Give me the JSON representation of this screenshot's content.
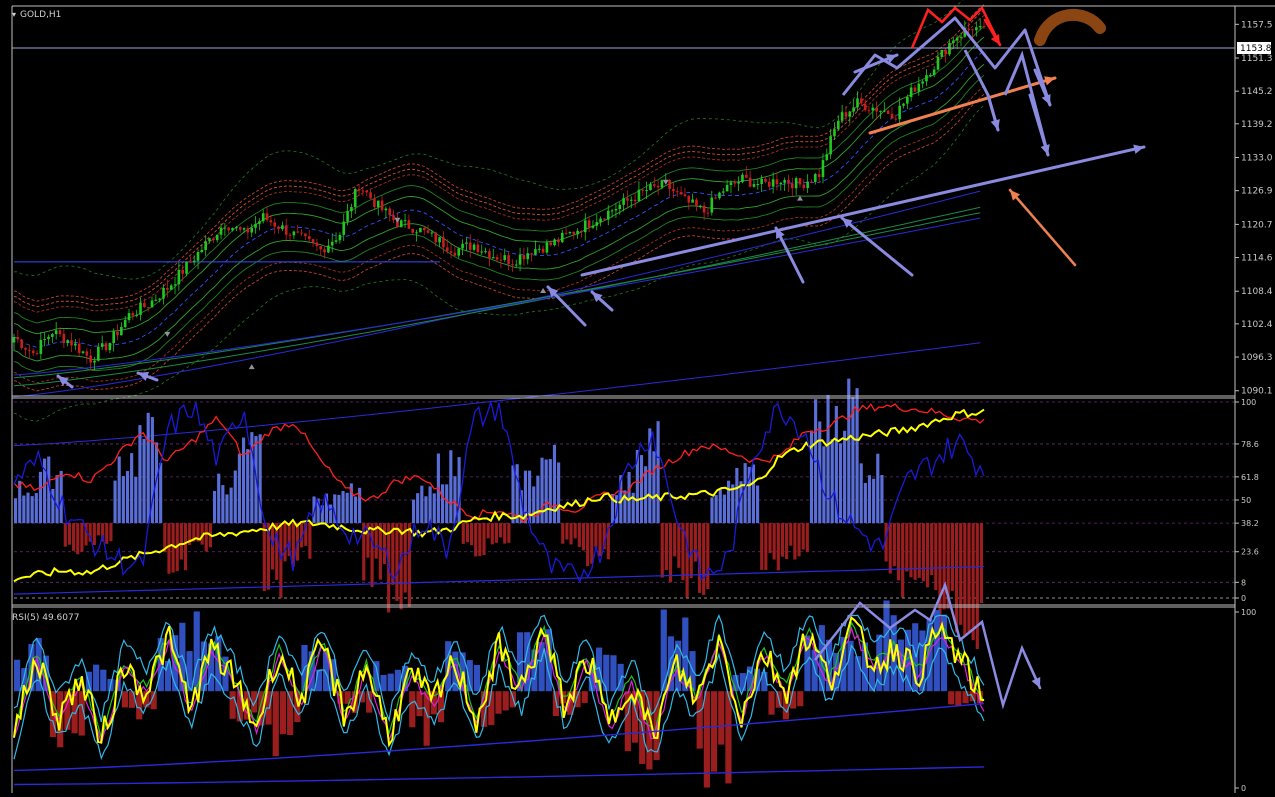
{
  "window": {
    "symbol_label": "GOLD,H1",
    "rsi_label": "RSI(5) 49.6077",
    "current_price": "1153.8",
    "colors": {
      "background": "#000000",
      "candle_up": "#22c822",
      "candle_down": "#c81e1e",
      "axis_text": "#c8c8c8",
      "annotation_blue": "#8a8ae0",
      "annotation_orange": "#f08050",
      "annotation_red": "#ff2020",
      "annotation_brown": "#8b4513",
      "rsi_yellow": "#ffff00",
      "line_red": "#ff2020",
      "line_blue": "#1a1ad8",
      "hist_up": "#5a6ed8",
      "hist_down": "#9a1e1e"
    }
  },
  "chart_data": [
    {
      "type": "candlestick",
      "title": "GOLD,H1",
      "y_tick_labels": [
        "1157.5",
        "1151.3",
        "1145.2",
        "1139.2",
        "1133.0",
        "1126.9",
        "1120.7",
        "1114.6",
        "1108.4",
        "1102.4",
        "1096.3",
        "1090.1"
      ],
      "ylim": [
        1089.5,
        1160.5
      ],
      "current_price": 1153.8,
      "price_path": [
        [
          0,
          1100
        ],
        [
          5,
          1097
        ],
        [
          10,
          1101
        ],
        [
          15,
          1099
        ],
        [
          20,
          1096
        ],
        [
          25,
          1099
        ],
        [
          30,
          1104
        ],
        [
          35,
          1106
        ],
        [
          40,
          1109
        ],
        [
          45,
          1113
        ],
        [
          50,
          1117
        ],
        [
          55,
          1121
        ],
        [
          60,
          1119
        ],
        [
          65,
          1122
        ],
        [
          70,
          1120
        ],
        [
          75,
          1118
        ],
        [
          80,
          1116
        ],
        [
          85,
          1119
        ],
        [
          90,
          1128
        ],
        [
          95,
          1124
        ],
        [
          100,
          1121
        ],
        [
          105,
          1120
        ],
        [
          110,
          1118
        ],
        [
          115,
          1116
        ],
        [
          120,
          1117
        ],
        [
          125,
          1115
        ],
        [
          130,
          1114
        ],
        [
          135,
          1116
        ],
        [
          140,
          1117
        ],
        [
          145,
          1119
        ],
        [
          150,
          1121
        ],
        [
          155,
          1123
        ],
        [
          160,
          1125
        ],
        [
          165,
          1127
        ],
        [
          170,
          1128
        ],
        [
          175,
          1125
        ],
        [
          180,
          1123
        ],
        [
          185,
          1127
        ],
        [
          190,
          1129
        ],
        [
          195,
          1128
        ],
        [
          200,
          1129
        ],
        [
          205,
          1128
        ],
        [
          210,
          1130
        ],
        [
          215,
          1140
        ],
        [
          220,
          1143
        ],
        [
          225,
          1142
        ],
        [
          230,
          1141
        ],
        [
          235,
          1146
        ],
        [
          240,
          1150
        ],
        [
          245,
          1155
        ],
        [
          250,
          1157
        ],
        [
          253,
          1156
        ]
      ],
      "n_bars": 254,
      "grid": false
    },
    {
      "type": "line",
      "title": "",
      "y_tick_labels": [
        "100",
        "78.6",
        "61.8",
        "50",
        "38.2",
        "23.6",
        "8",
        "0"
      ],
      "ylim": [
        0,
        100
      ],
      "series": [
        {
          "name": "",
          "color": "#ff2020",
          "values": [
            58,
            55,
            65,
            60,
            72,
            85,
            70,
            80,
            92,
            72,
            85,
            90,
            70,
            55,
            50,
            60,
            62,
            50,
            42,
            45,
            40,
            48,
            45,
            52,
            55,
            65,
            72,
            78,
            75,
            70,
            72,
            85,
            88,
            96,
            98,
            97,
            95,
            92,
            90
          ]
        },
        {
          "name": "",
          "color": "#ffff00",
          "values": [
            10,
            12,
            14,
            13,
            18,
            22,
            26,
            30,
            32,
            34,
            36,
            38,
            38,
            36,
            34,
            35,
            33,
            35,
            40,
            42,
            42,
            46,
            48,
            52,
            50,
            51,
            52,
            53,
            55,
            58,
            72,
            78,
            80,
            82,
            84,
            86,
            90,
            94,
            95
          ]
        },
        {
          "name": "",
          "color": "#1a1ad8",
          "values": [
            60,
            70,
            45,
            30,
            20,
            15,
            85,
            98,
            70,
            98,
            30,
            20,
            50,
            35,
            28,
            15,
            40,
            25,
            90,
            98,
            45,
            15,
            10,
            25,
            65,
            85,
            40,
            10,
            20,
            75,
            98,
            85,
            50,
            35,
            25,
            60,
            70,
            80,
            65
          ]
        }
      ],
      "histogram": [
        12,
        18,
        -10,
        -6,
        22,
        30,
        -14,
        -8,
        15,
        25,
        -20,
        -12,
        8,
        14,
        -18,
        -24,
        10,
        20,
        -10,
        -6,
        16,
        22,
        -8,
        -12,
        14,
        30,
        -16,
        -20,
        12,
        18,
        -14,
        -10,
        36,
        42,
        20,
        -20,
        -26,
        -30,
        -34
      ]
    },
    {
      "type": "line",
      "title": "RSI(5) 49.6077",
      "y_tick_labels": [
        "100",
        "0"
      ],
      "ylim": [
        0,
        100
      ],
      "series": [
        {
          "name": "",
          "color": "#ffff00",
          "values": [
            30,
            75,
            40,
            62,
            28,
            70,
            55,
            85,
            45,
            80,
            60,
            35,
            78,
            50,
            82,
            40,
            70,
            30,
            65,
            48,
            72,
            38,
            80,
            55,
            90,
            45,
            75,
            35,
            62,
            28,
            70,
            50,
            85,
            40,
            78,
            55,
            88,
            60,
            92,
            70,
            80,
            65,
            90,
            72,
            48
          ]
        },
        {
          "name": "",
          "color": "#1a1ad8",
          "values": [
            15,
            17,
            19,
            21,
            23,
            26,
            28,
            31,
            34,
            37,
            40,
            43,
            46,
            49,
            52,
            55,
            58,
            61,
            64,
            67,
            70,
            73,
            76,
            79,
            82
          ]
        }
      ],
      "histogram": [
        20,
        -30,
        10,
        -12,
        25,
        30,
        -15,
        -25,
        18,
        -8,
        12,
        -20,
        22,
        -14,
        28,
        -10,
        16,
        -30,
        35,
        -40,
        10,
        -12,
        26,
        20,
        38,
        30,
        -6
      ]
    }
  ]
}
